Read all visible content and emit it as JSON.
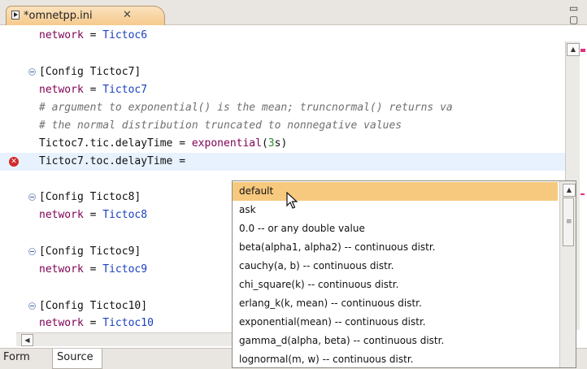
{
  "tab": {
    "title": "*omnetpp.ini",
    "close_glyph": "✕"
  },
  "window_controls": "▭ ▢",
  "editor": {
    "lines": [
      {
        "id": "l0",
        "key": "network",
        "value": "Tictoc6"
      },
      {
        "id": "l2",
        "section": "[Config Tictoc7]"
      },
      {
        "id": "l3",
        "key": "network",
        "value": "Tictoc7"
      },
      {
        "id": "l4",
        "comment": "# argument to exponential() is the mean; truncnormal() returns va"
      },
      {
        "id": "l5",
        "comment": "# the normal distribution truncated to nonnegative values"
      },
      {
        "id": "l6",
        "key": "Tictoc7.tic.delayTime",
        "fn": "exponential",
        "arg": "3",
        "unit": "s"
      },
      {
        "id": "l7",
        "key": "Tictoc7.toc.delayTime",
        "value": ""
      },
      {
        "id": "l9",
        "section": "[Config Tictoc8]"
      },
      {
        "id": "l10",
        "key": "network",
        "value": "Tictoc8"
      },
      {
        "id": "l12",
        "section": "[Config Tictoc9]"
      },
      {
        "id": "l13",
        "key": "network",
        "value": "Tictoc9"
      },
      {
        "id": "l15",
        "section": "[Config Tictoc10]"
      },
      {
        "id": "l16",
        "key": "network",
        "value": "Tictoc10"
      }
    ],
    "error_glyph": "✕"
  },
  "popup": {
    "selected_index": 0,
    "proposals": [
      "default",
      "ask",
      "0.0 -- or any double value",
      "beta(alpha1, alpha2) -- continuous distr.",
      "cauchy(a, b) -- continuous distr.",
      "chi_square(k) -- continuous distr.",
      "erlang_k(k, mean) -- continuous distr.",
      "exponential(mean) -- continuous distr.",
      "gamma_d(alpha, beta) -- continuous distr.",
      "lognormal(m, w) -- continuous distr."
    ],
    "grip_glyph": "≡"
  },
  "bottom_tabs": {
    "form": "Form",
    "source": "Source"
  },
  "colors": {
    "selection": "#f7c97e",
    "tab_active": "#f5c98c",
    "error": "#d12a2a",
    "keyword": "#7f0055"
  }
}
